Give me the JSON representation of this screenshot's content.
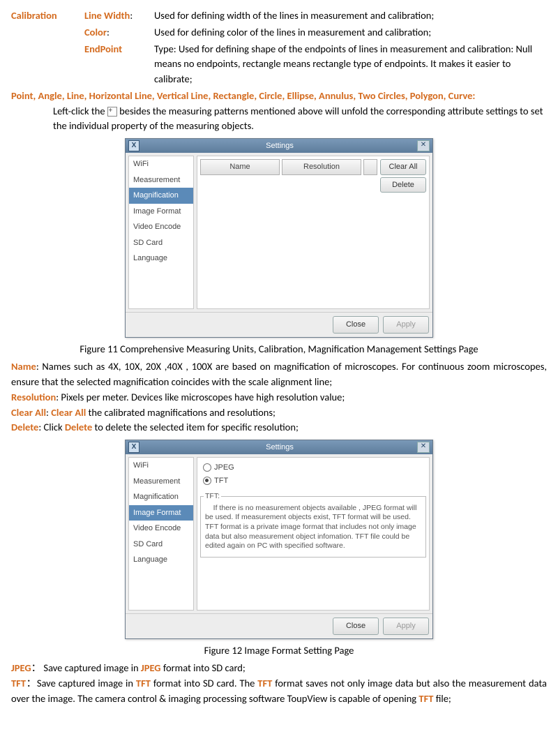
{
  "calib": {
    "heading": "Calibration",
    "linewidth": {
      "label": "Line Width",
      "text": "Used for defining width of the lines in measurement and calibration;"
    },
    "color": {
      "label": "Color",
      "text": "Used for defining color of the lines in measurement and calibration;"
    },
    "endpoint": {
      "label": "EndPoint",
      "text": "Type: Used for defining shape of the endpoints of lines in measurement and calibration: Null means no endpoints, rectangle means rectangle type of endpoints. It makes it easier to calibrate;"
    }
  },
  "patterns": "Point, Angle, Line, Horizontal Line, Vertical Line, Rectangle, Circle, Ellipse, Annulus, Two Circles, Polygon, Curve",
  "patterns_text_a": "Left-click the",
  "patterns_text_b": "besides the measuring patterns mentioned above will unfold the corresponding attribute settings to set the individual property of the measuring objects.",
  "dialog_title": "Settings",
  "sidebar_items": [
    "WiFi",
    "Measurement",
    "Magnification",
    "Image Format",
    "Video Encode",
    "SD Card",
    "Language"
  ],
  "mag": {
    "col_name": "Name",
    "col_res": "Resolution",
    "btn_clear": "Clear All",
    "btn_delete": "Delete"
  },
  "footer": {
    "close": "Close",
    "apply": "Apply"
  },
  "fig11": "Figure 11 Comprehensive Measuring Units, Calibration, Magnification Management Settings Page",
  "name": {
    "label": "Name",
    "text": ": Names such as 4X, 10X, 20X ,40X , 100X are based on magnification of microscopes. For continuous zoom microscopes, ensure that the selected magnification coincides with the scale alignment line;"
  },
  "reso": {
    "label": "Resolution",
    "text": ": Pixels per meter. Devices like microscopes have high resolution value;"
  },
  "clearall": {
    "label": "Clear All",
    "text1": ": ",
    "text2": " the calibrated magnifications and resolutions;"
  },
  "delete": {
    "label": "Delete",
    "text1": ": Click ",
    "text2": " to delete the selected item for specific resolution;"
  },
  "imgfmt": {
    "jpeg": "JPEG",
    "tft": "TFT",
    "tft_label": "TFT:",
    "tft_desc": "    If there is no measurement objects available , JPEG format will be used. If measurement objects exist, TFT format will be used.  TFT format is a private image format that includes not only image data but also measurement object infomation. TFT file could be edited again on PC with specified software."
  },
  "fig12": "Figure 12 Image Format Setting Page",
  "jpeg_desc": {
    "label": "JPEG",
    "sep": "：",
    "text1": "Save captured image in ",
    "text2": " format into SD card;"
  },
  "tft_desc": {
    "label": "TFT",
    "sep": "：",
    "text1": "Save captured image in ",
    "text2": " format into SD card. The ",
    "text3": " format saves not only image data but also the measurement data over the image. The camera control & imaging processing software ToupView is capable of opening ",
    "text4": " file;"
  }
}
